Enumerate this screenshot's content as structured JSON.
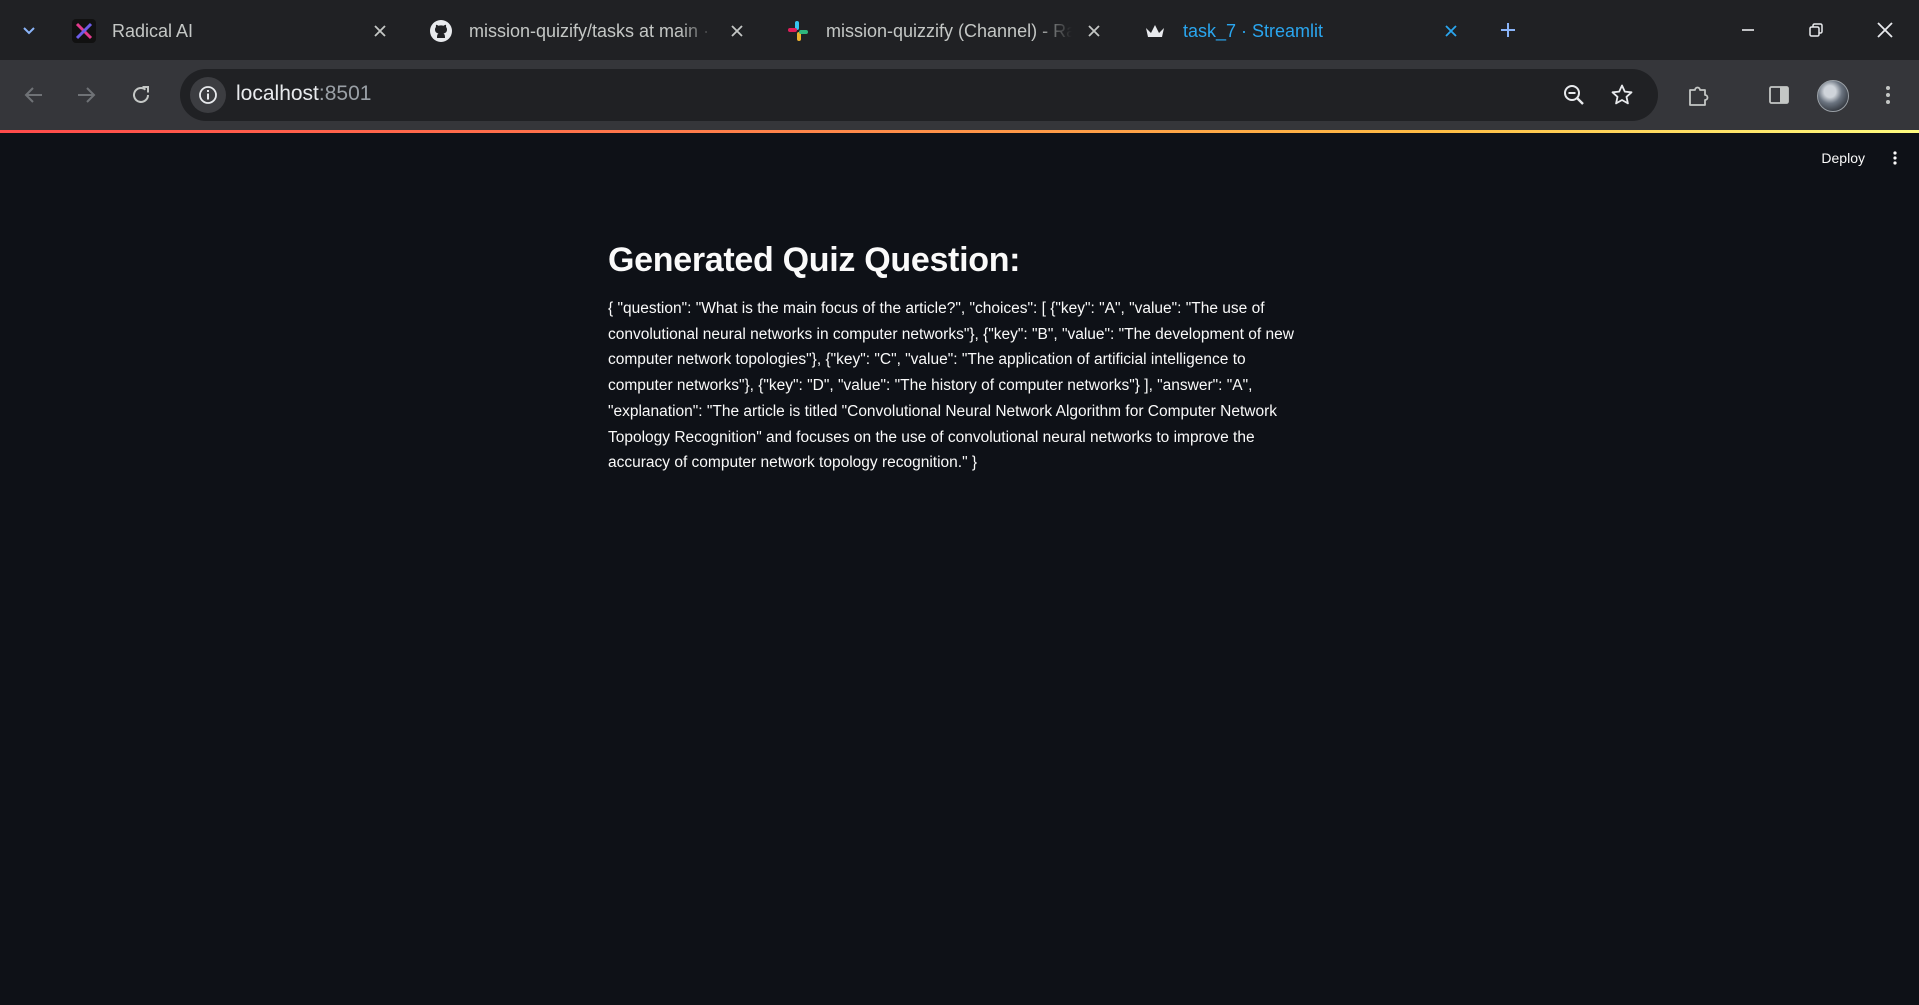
{
  "browser": {
    "tabs": [
      {
        "title": "Radical AI",
        "favicon": "radical-ai-favicon",
        "active": false
      },
      {
        "title": "mission-quizify/tasks at main · radical-ai",
        "favicon": "github-icon",
        "active": false
      },
      {
        "title": "mission-quizzify (Channel) - Radical AI - Slack",
        "favicon": "slack-icon",
        "active": false
      },
      {
        "title": "task_7 · Streamlit",
        "favicon": "streamlit-icon",
        "active": true
      }
    ],
    "address": {
      "host": "localhost",
      "port": ":8501"
    }
  },
  "app": {
    "deploy_label": "Deploy",
    "heading": "Generated Quiz Question:",
    "quiz_json": "{ \"question\": \"What is the main focus of the article?\", \"choices\": [ {\"key\": \"A\", \"value\": \"The use of convolutional neural networks in computer networks\"}, {\"key\": \"B\", \"value\": \"The development of new computer network topologies\"}, {\"key\": \"C\", \"value\": \"The application of artificial intelligence to computer networks\"}, {\"key\": \"D\", \"value\": \"The history of computer networks\"} ], \"answer\": \"A\", \"explanation\": \"The article is titled \"Convolutional Neural Network Algorithm for Computer Network Topology Recognition\" and focuses on the use of convolutional neural networks to improve the accuracy of computer network topology recognition.\" }"
  },
  "colors": {
    "page_background": "#0e1117",
    "text": "#fafafa",
    "active_tab": "#2aa6ef",
    "tabstrip": "#202124",
    "toolbar": "#35363a"
  }
}
